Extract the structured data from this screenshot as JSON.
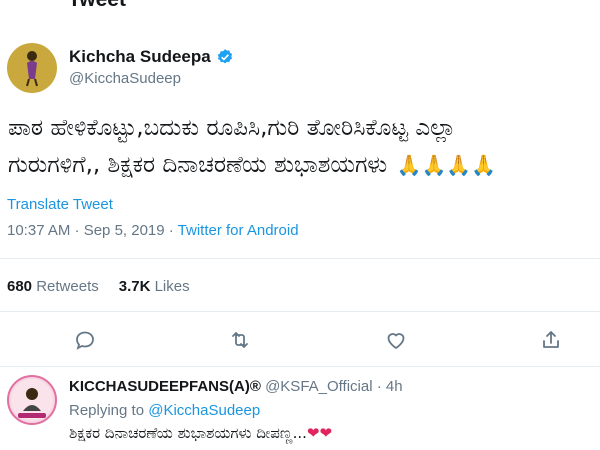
{
  "header": {
    "title": "Tweet"
  },
  "tweet": {
    "author_name": "Kichcha Sudeepa",
    "author_handle": "@KicchaSudeep",
    "text_line1": "ಪಾಠ ಹೇಳಿಕೊಟ್ಟು,ಬದುಕು ರೂಪಿಸಿ,ಗುರಿ ತೋರಿಸಿಕೊಟ್ಟ ಎಲ್ಲಾ",
    "text_line2": "ಗುರುಗಳಿಗೆ,,  ಶಿಕ್ಷಕರ ದಿನಾಚರಣೆಯ ಶುಭಾಶಯಗಳು",
    "emoji": "🙏🙏🙏🙏",
    "translate_label": "Translate Tweet",
    "time": "10:37 AM · Sep 5, 2019 · ",
    "source": "Twitter for Android"
  },
  "stats": {
    "retweets_count": "680",
    "retweets_label": "Retweets",
    "likes_count": "3.7K",
    "likes_label": "Likes"
  },
  "actions": [
    "reply-icon",
    "retweet-icon",
    "like-icon",
    "share-icon"
  ],
  "reply": {
    "author_name": "KICCHASUDEEPFANS(A)®",
    "author_handle": "@KSFA_Official · 4h",
    "replying_label": "Replying to ",
    "replying_to": "@KicchaSudeep",
    "text": "ಶಿಕ್ಷಕರ ದಿನಾಚರಣೆಯ ಶುಭಾಶಯಗಳು ದೀಪಣ್ಣ...",
    "hearts": "❤❤"
  },
  "colors": {
    "accent": "#1b95e0",
    "muted": "#657786",
    "text": "#14171a",
    "heart": "#e0245e"
  }
}
